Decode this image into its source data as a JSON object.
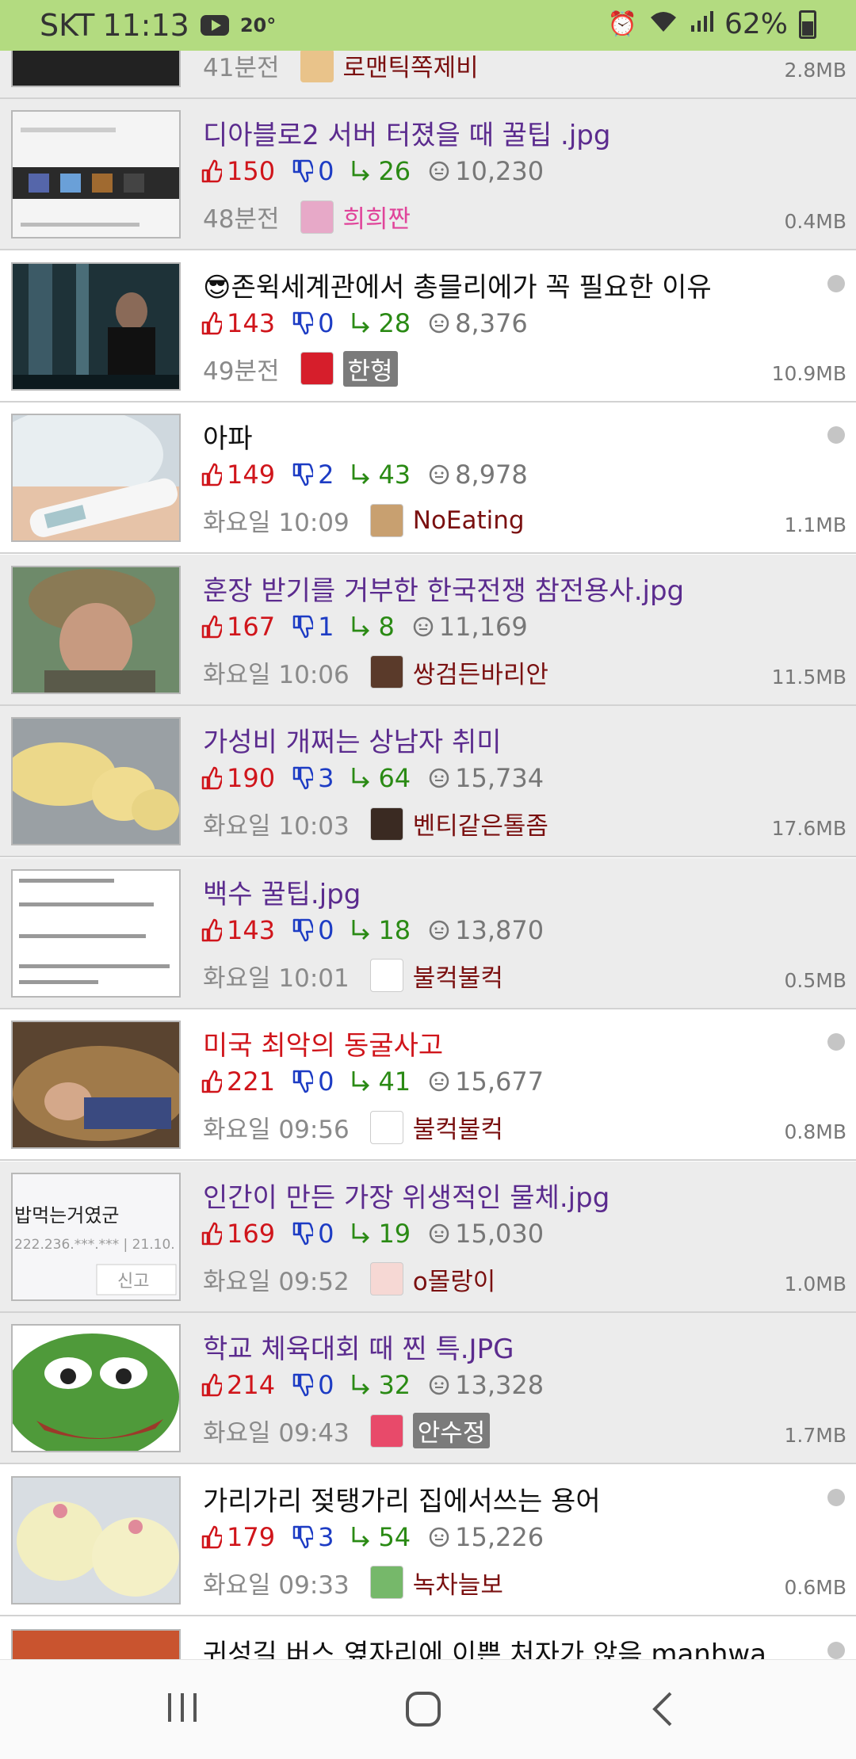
{
  "status": {
    "carrier": "SKT",
    "time": "11:13",
    "temperature": "20°",
    "battery": "62%"
  },
  "colors": {
    "status_bg": "#b3db80",
    "upvote": "#d0151b",
    "downvote": "#1d3cc4",
    "reply": "#2a8a14",
    "visited_title": "#5b2b8e"
  },
  "partial_top": {
    "time": "41분전",
    "author": "로맨틱쪽제비",
    "size": "2.8MB"
  },
  "posts": [
    {
      "title": "디아블로2 서버 터졌을 때 꿀팁 .jpg",
      "title_style": "visited",
      "up": "150",
      "down": "0",
      "replies": "26",
      "views": "10,230",
      "time": "48분전",
      "author": "희희짠",
      "author_style": "pink",
      "size": "0.4MB",
      "dot": false,
      "bg": "gray",
      "thumb": "screenshot-ui"
    },
    {
      "title": "😎존윅세계관에서 총믈리에가 꼭 필요한 이유",
      "title_style": "unread",
      "up": "143",
      "down": "0",
      "replies": "28",
      "views": "8,376",
      "time": "49분전",
      "author": "한형",
      "author_style": "boxed",
      "size": "10.9MB",
      "dot": true,
      "bg": "white",
      "thumb": "movie-scene"
    },
    {
      "title": "아파",
      "title_style": "unread",
      "up": "149",
      "down": "2",
      "replies": "43",
      "views": "8,978",
      "time": "화요일 10:09",
      "author": "NoEating",
      "author_style": "normal",
      "size": "1.1MB",
      "dot": true,
      "bg": "white",
      "thumb": "thermometer"
    },
    {
      "title": "훈장 받기를 거부한 한국전쟁 참전용사.jpg",
      "title_style": "visited",
      "up": "167",
      "down": "1",
      "replies": "8",
      "views": "11,169",
      "time": "화요일 10:06",
      "author": "쌍검든바리안",
      "author_style": "normal",
      "size": "11.5MB",
      "dot": false,
      "bg": "gray",
      "thumb": "veteran"
    },
    {
      "title": "가성비 개쩌는 상남자 취미",
      "title_style": "visited",
      "up": "190",
      "down": "3",
      "replies": "64",
      "views": "15,734",
      "time": "화요일 10:03",
      "author": "벤티같은톨좀",
      "author_style": "normal",
      "size": "17.6MB",
      "dot": false,
      "bg": "gray",
      "thumb": "butter"
    },
    {
      "title": "백수 꿀팁.jpg",
      "title_style": "visited",
      "up": "143",
      "down": "0",
      "replies": "18",
      "views": "13,870",
      "time": "화요일 10:01",
      "author": "불컥불컥",
      "author_style": "normal",
      "size": "0.5MB",
      "dot": false,
      "bg": "gray",
      "thumb": "text-screenshot"
    },
    {
      "title": "미국 최악의 동굴사고",
      "title_style": "red",
      "up": "221",
      "down": "0",
      "replies": "41",
      "views": "15,677",
      "time": "화요일 09:56",
      "author": "불컥불컥",
      "author_style": "normal",
      "size": "0.8MB",
      "dot": true,
      "bg": "white",
      "thumb": "cave"
    },
    {
      "title": "인간이 만든 가장 위생적인 물체.jpg",
      "title_style": "visited",
      "up": "169",
      "down": "0",
      "replies": "19",
      "views": "15,030",
      "time": "화요일 09:52",
      "author": "o몰랑이",
      "author_style": "normal",
      "size": "1.0MB",
      "dot": false,
      "bg": "gray",
      "thumb": "comment-capture"
    },
    {
      "title": "학교 체육대회 때 찐 특.JPG",
      "title_style": "visited",
      "up": "214",
      "down": "0",
      "replies": "32",
      "views": "13,328",
      "time": "화요일 09:43",
      "author": "안수정",
      "author_style": "boxed",
      "size": "1.7MB",
      "dot": false,
      "bg": "gray",
      "thumb": "pepe"
    },
    {
      "title": "가리가리 젖탱가리 집에서쓰는 용어",
      "title_style": "unread",
      "up": "179",
      "down": "3",
      "replies": "54",
      "views": "15,226",
      "time": "화요일 09:33",
      "author": "녹차늘보",
      "author_style": "normal",
      "size": "0.6MB",
      "dot": true,
      "bg": "white",
      "thumb": "pudding"
    }
  ],
  "partial_bottom": {
    "title": "귀성길 버스 옆자리에 이쁜 처자가 앉음.manhwa"
  },
  "thumb_text": {
    "ip_line1": "밥먹는거였군",
    "ip_line2": "222.236.***.*** | 21.10.",
    "report_btn": "신고"
  }
}
